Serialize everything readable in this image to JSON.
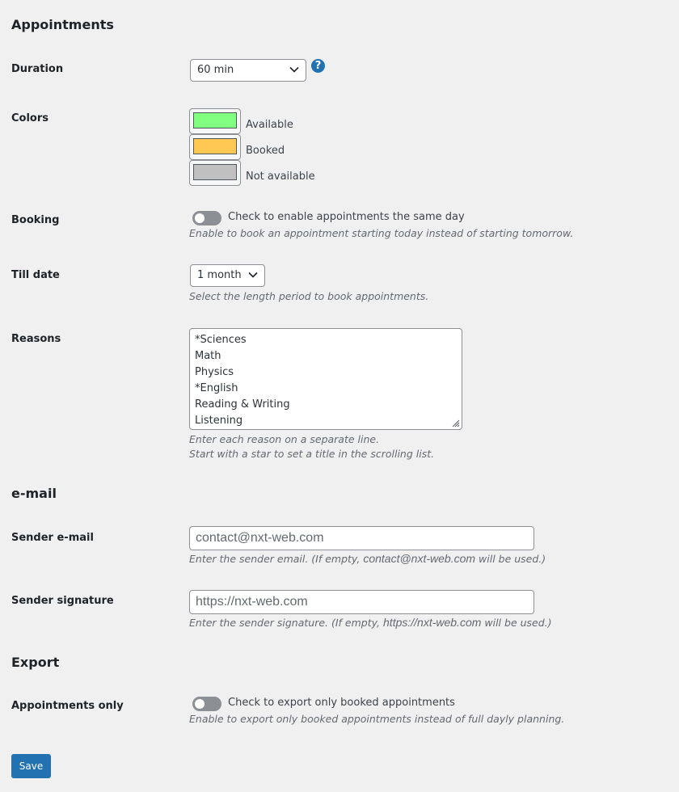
{
  "sections": {
    "appointments": "Appointments",
    "email": "e-mail",
    "export": "Export"
  },
  "duration": {
    "label": "Duration",
    "value": "60 min",
    "help_icon": "question-circle-icon"
  },
  "colors": {
    "label": "Colors",
    "items": [
      {
        "label": "Available",
        "color": "#80ff80"
      },
      {
        "label": "Booked",
        "color": "#ffc853"
      },
      {
        "label": "Not available",
        "color": "#c0c0c0"
      }
    ]
  },
  "booking": {
    "label": "Booking",
    "toggle_text": "Check to enable appointments the same day",
    "description": "Enable to book an appointment starting today instead of starting tomorrow.",
    "enabled": false
  },
  "till_date": {
    "label": "Till date",
    "value": "1 month",
    "description": "Select the length period to book appointments."
  },
  "reasons": {
    "label": "Reasons",
    "lines": [
      "*Sciences",
      "Math",
      "Physics",
      "*English",
      "Reading & Writing",
      "Listening"
    ],
    "description_1": "Enter each reason on a separate line.",
    "description_2": "Start with a star to set a title in the scrolling list."
  },
  "sender_email": {
    "label": "Sender e-mail",
    "placeholder": "contact@nxt-web.com",
    "desc_prefix": "Enter the sender email. (If empty,",
    "desc_value": "contact@nxt-web.com",
    "desc_suffix": "will be used.)"
  },
  "sender_signature": {
    "label": "Sender signature",
    "placeholder": "https://nxt-web.com",
    "desc_prefix": "Enter the sender signature. (If empty,",
    "desc_value": "https://nxt-web.com",
    "desc_suffix": "will be used.)"
  },
  "appointments_only": {
    "label": "Appointments only",
    "toggle_text": "Check to export only booked appointments",
    "description": "Enable to export only booked appointments instead of full dayly planning.",
    "enabled": false
  },
  "save_label": "Save"
}
